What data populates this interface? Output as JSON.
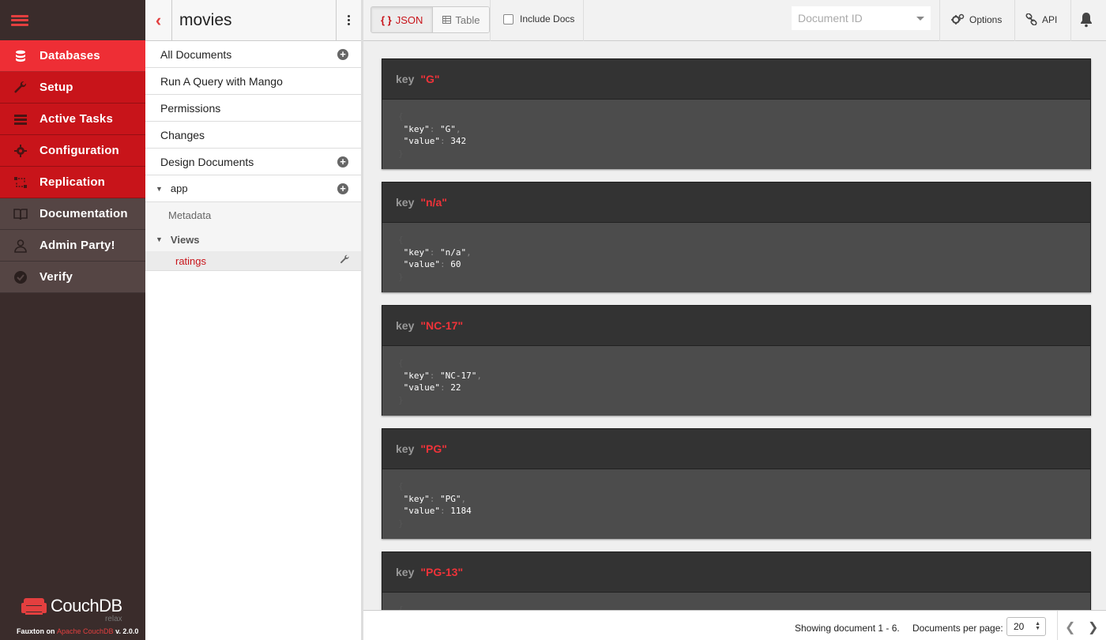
{
  "nav": {
    "items": [
      {
        "label": "Databases",
        "icon": "database-icon"
      },
      {
        "label": "Setup",
        "icon": "wrench-icon"
      },
      {
        "label": "Active Tasks",
        "icon": "tasks-icon"
      },
      {
        "label": "Configuration",
        "icon": "gear-icon"
      },
      {
        "label": "Replication",
        "icon": "replication-icon"
      },
      {
        "label": "Documentation",
        "icon": "book-icon"
      },
      {
        "label": "Admin Party!",
        "icon": "user-icon"
      },
      {
        "label": "Verify",
        "icon": "check-circle-icon"
      }
    ],
    "brand": "CouchDB",
    "brand_tagline": "relax",
    "footer_prefix": "Fauxton on",
    "footer_link": "Apache CouchDB",
    "footer_version": "v. 2.0.0"
  },
  "sidebar": {
    "title": "movies",
    "all_documents": "All Documents",
    "mango": "Run A Query with Mango",
    "permissions": "Permissions",
    "changes": "Changes",
    "design_documents": "Design Documents",
    "ddoc": "app",
    "metadata": "Metadata",
    "views": "Views",
    "view_name": "ratings"
  },
  "toolbar": {
    "json_label": "JSON",
    "json_icon": "{ }",
    "table_label": "Table",
    "include_docs": "Include Docs",
    "docid_placeholder": "Document ID",
    "options": "Options",
    "api": "API"
  },
  "results": {
    "key_label": "key",
    "rows": [
      {
        "key": "\"G\"",
        "key_json": "\"G\"",
        "value": "342"
      },
      {
        "key": "\"n/a\"",
        "key_json": "\"n/a\"",
        "value": "60"
      },
      {
        "key": "\"NC-17\"",
        "key_json": "\"NC-17\"",
        "value": "22"
      },
      {
        "key": "\"PG\"",
        "key_json": "\"PG\"",
        "value": "1184"
      },
      {
        "key": "\"PG-13\"",
        "key_json": "",
        "value": ""
      }
    ]
  },
  "footer": {
    "showing": "Showing document 1 - 6.",
    "per_page_label": "Documents per page:",
    "per_page_value": "20"
  },
  "colors": {
    "accent": "#c8141a",
    "active_nav": "#ee2e35",
    "nav_bg": "#3a2c2b"
  }
}
